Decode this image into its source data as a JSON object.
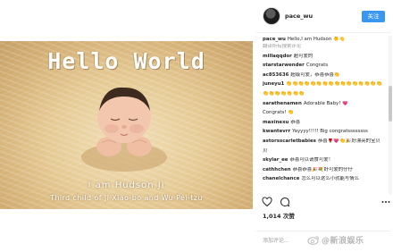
{
  "post": {
    "image_title": "Hello World",
    "caption_line1": "I am Hudson Ji",
    "caption_line2": "Third child of Ji Xiao-bo and Wu Pei-tzu"
  },
  "header": {
    "username": "pace_wu",
    "follow_label": "关注"
  },
  "comments": [
    {
      "user": "pace_wu",
      "text": "Hello,I am Hudson 🐥👋"
    },
    {
      "user": "",
      "text": "翻译所有搜索评论",
      "sub": true
    },
    {
      "user": "millaqqdor",
      "text": "超可爱的"
    },
    {
      "user": "starstarwender",
      "text": "Congrats"
    },
    {
      "user": "ac853636",
      "text": "超级可爱，恭喜恭喜👏"
    },
    {
      "user": "juneyu1",
      "text": "👏👏👏👏👏👏👏👏👏👏👏👏👏👏👏👏"
    },
    {
      "user": "",
      "text": "👏👏👏👏👏👏👏",
      "sub": false
    },
    {
      "user": "sarathenamen",
      "text": "Adorable Baby! 💗"
    },
    {
      "user": "",
      "text": "Congrats! 👏",
      "sub": false
    },
    {
      "user": "maxinexu",
      "text": "恭喜"
    },
    {
      "user": "kwantevrr",
      "text": "Yayyyy!!!!! Big congratssssssss"
    },
    {
      "user": "astorsscarletbabies",
      "text": "恭喜🌹💗👏🎉好漂亮的宝贝"
    },
    {
      "user": "",
      "text": "贝",
      "sub": false
    },
    {
      "user": "skylar_ee",
      "text": "恭喜可以请食可爱！"
    },
    {
      "user": "cathhchen",
      "text": "恭喜恭喜🎉💐好可爱的仔仔"
    },
    {
      "user": "chanelchance",
      "text": "怎么可以这么小就能写情么"
    }
  ],
  "actions": {
    "likes_text": "1,014 次赞",
    "add_comment_placeholder": "添加评论..."
  },
  "watermark": {
    "text": "@新浪娱乐"
  }
}
